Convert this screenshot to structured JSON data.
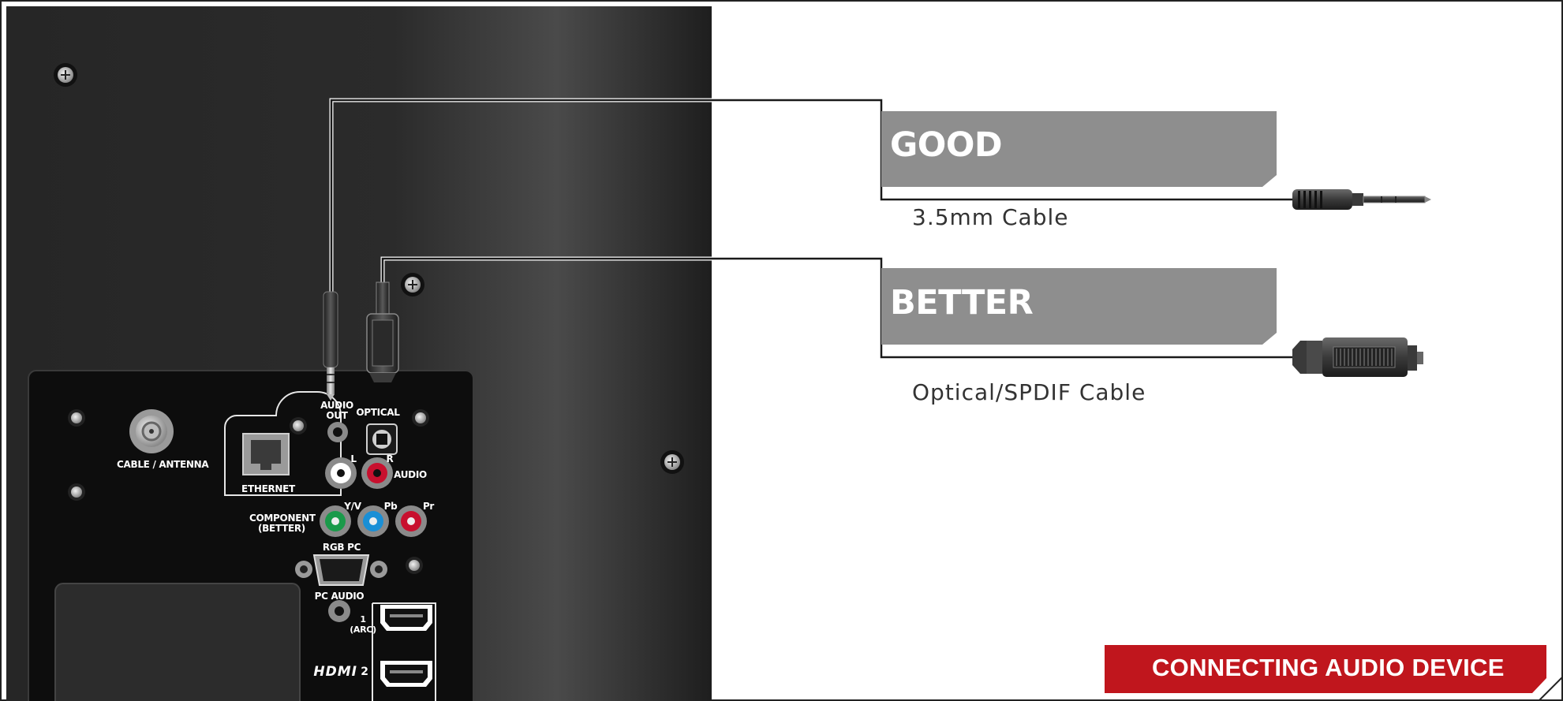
{
  "ports": {
    "cable_antenna": "CABLE / ANTENNA",
    "ethernet": "ETHERNET",
    "audio_out": "AUDIO OUT",
    "optical": "OPTICAL",
    "left": "L",
    "right": "R",
    "audio": "AUDIO",
    "component": "COMPONENT (BETTER)",
    "yv": "Y/V",
    "pb": "Pb",
    "pr": "Pr",
    "rgb_pc": "RGB PC",
    "pc_audio": "PC AUDIO",
    "hdmi1": "1 (ARC)",
    "hdmi_logo": "HDMI",
    "hdmi2": "2"
  },
  "options": [
    {
      "tier": "GOOD",
      "cable": "3.5mm Cable"
    },
    {
      "tier": "BETTER",
      "cable": "Optical/SPDIF Cable"
    }
  ],
  "footer": {
    "title": "CONNECTING AUDIO DEVICE"
  },
  "colors": {
    "tv_body": "#2a2a2a",
    "panel": "#0f0f0f",
    "tier_box": "#8e8e8e",
    "footer_red": "#c0161d",
    "component_green": "#1a9a4a",
    "component_blue": "#1a8fd6",
    "audio_red": "#c8102e",
    "cable_line": "#1a1a1a"
  }
}
